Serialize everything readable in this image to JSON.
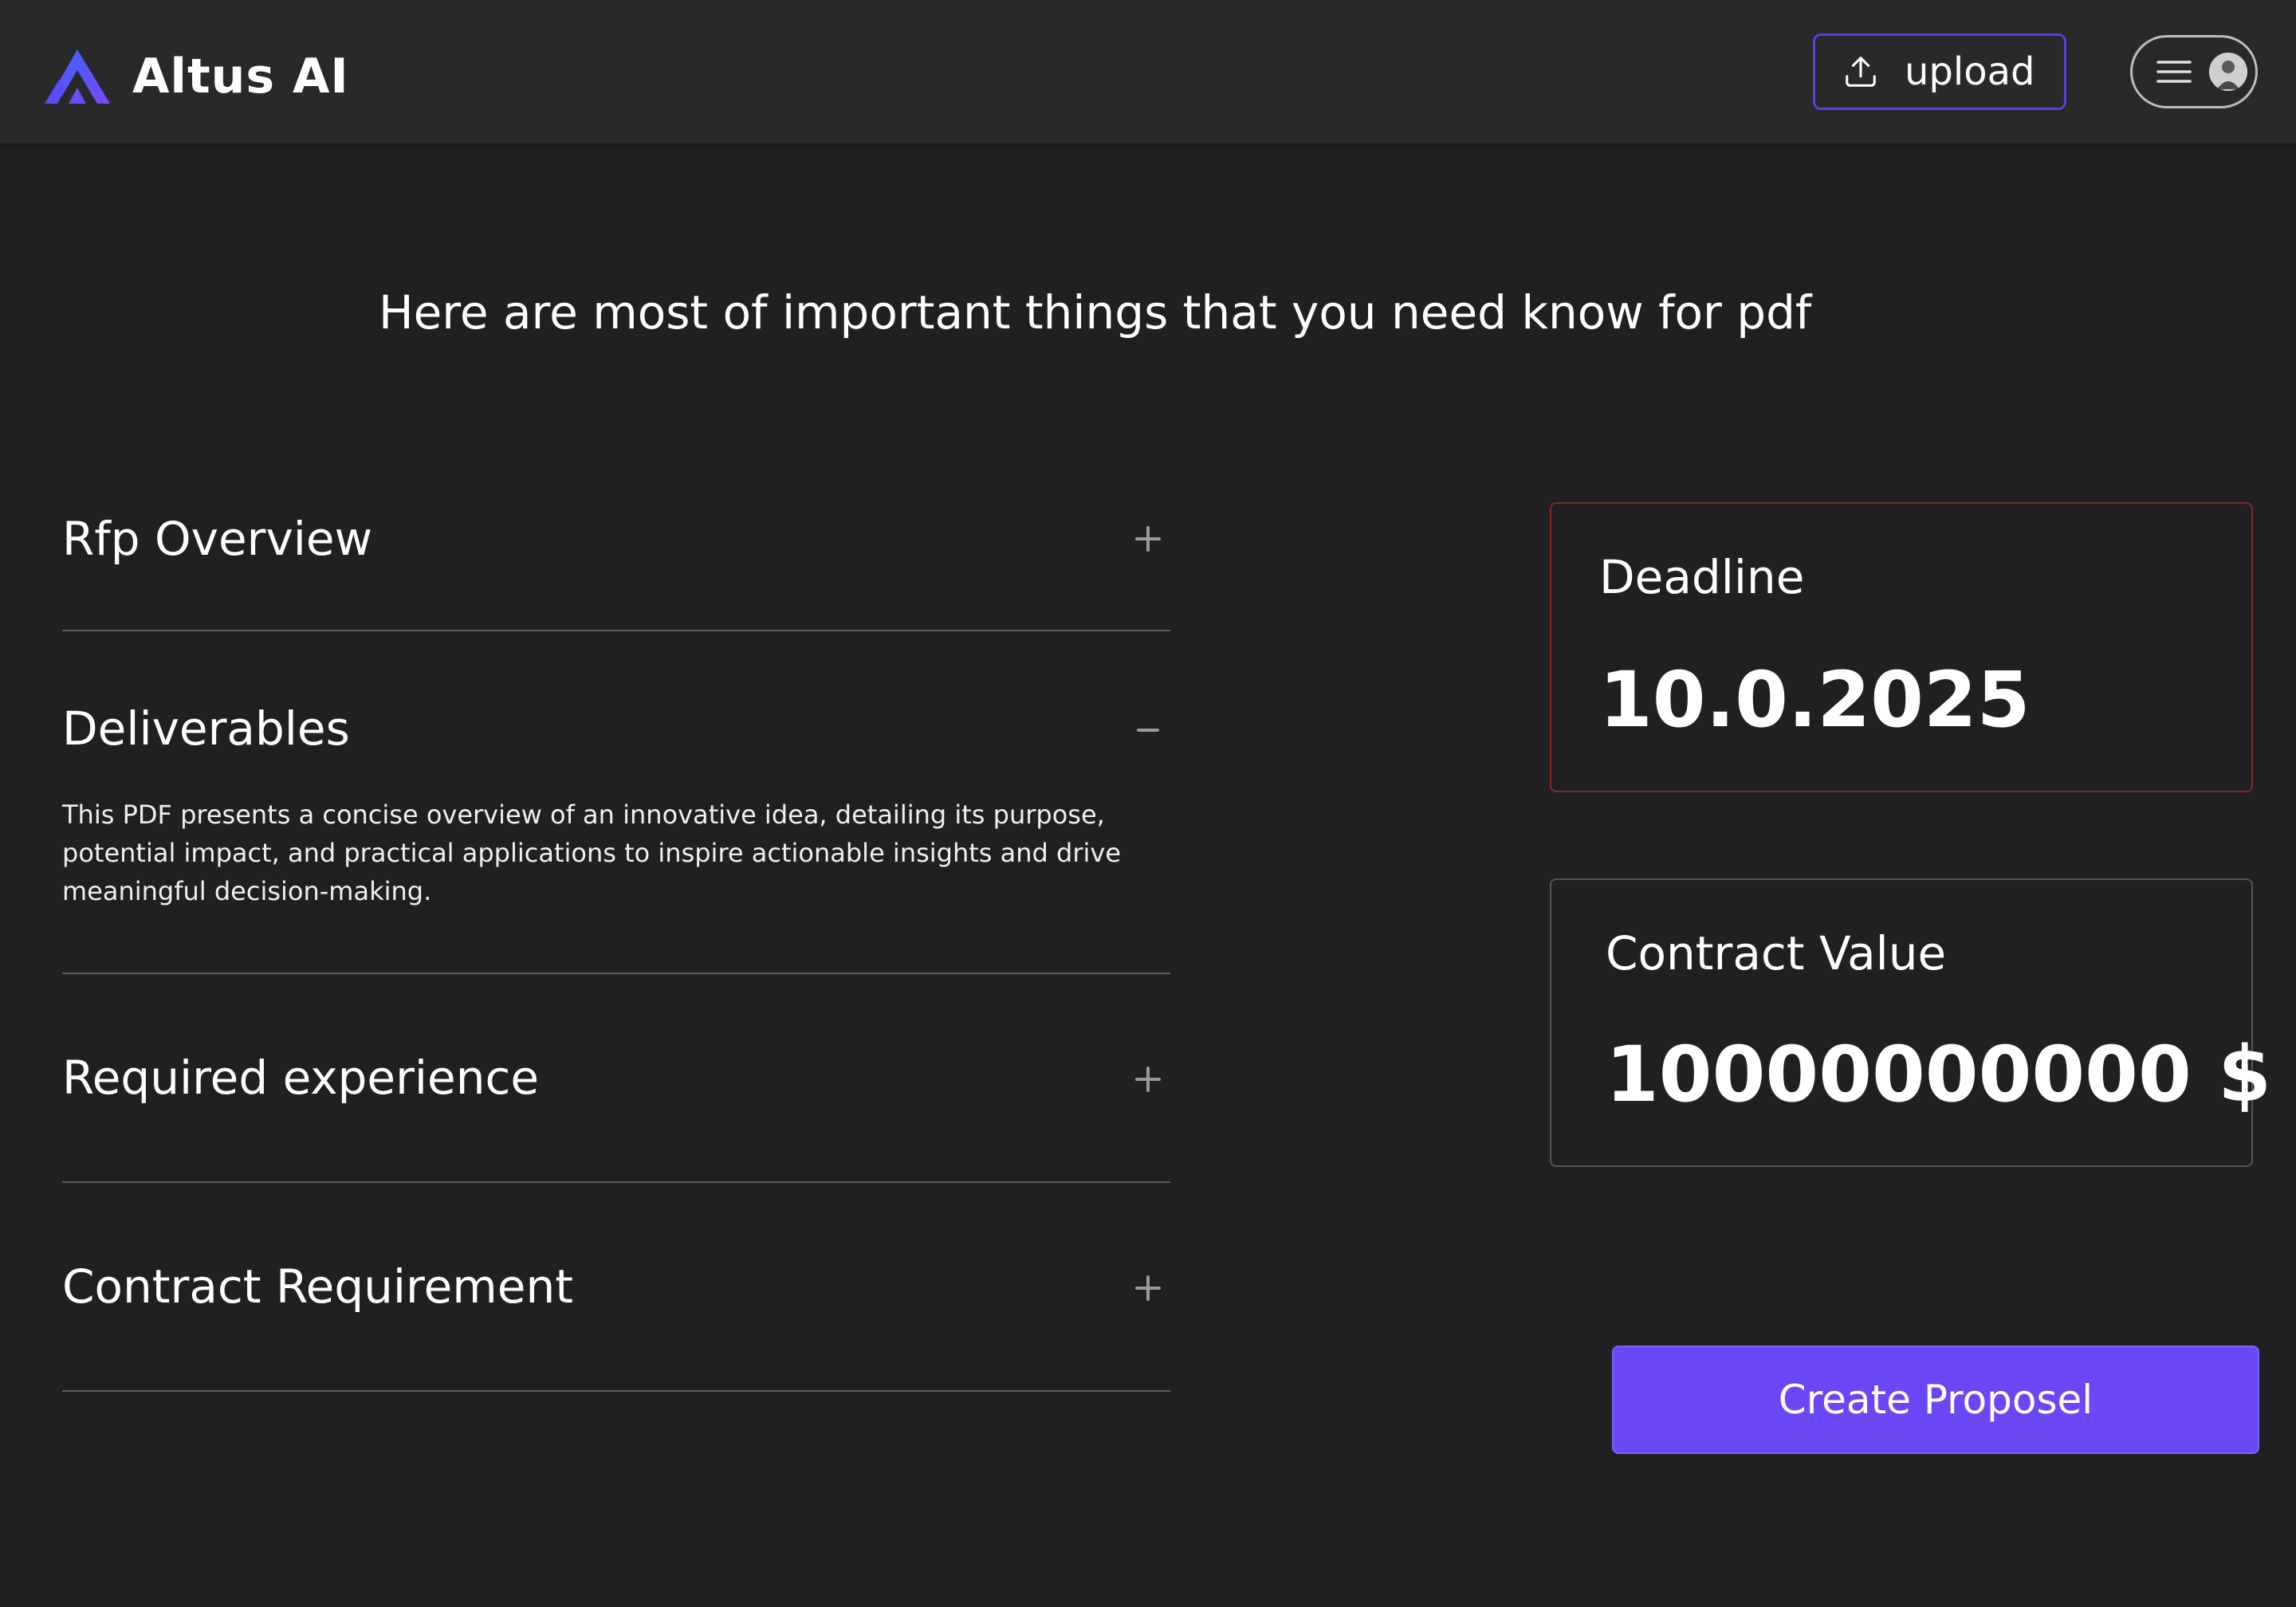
{
  "header": {
    "brand": "Altus AI",
    "upload_label": "upload",
    "icons": {
      "logo": "altus-logo",
      "upload": "upload-icon",
      "menu": "hamburger-icon",
      "avatar": "user-avatar"
    }
  },
  "headline": "Here are most of important things that you need know for pdf",
  "accordion": {
    "items": [
      {
        "title": "Rfp Overview",
        "expanded": false,
        "toggle": "+"
      },
      {
        "title": "Deliverables",
        "expanded": true,
        "toggle": "−",
        "body": "This PDF presents a concise overview of an innovative idea, detailing its purpose, potential impact, and practical applications to inspire actionable insights and drive meaningful decision-making."
      },
      {
        "title": "Required experience",
        "expanded": false,
        "toggle": "+"
      },
      {
        "title": "Contract Requirement",
        "expanded": false,
        "toggle": "+"
      }
    ]
  },
  "cards": {
    "deadline": {
      "label": "Deadline",
      "value": "10.0.2025"
    },
    "contract_value": {
      "label": "Contract Value",
      "value": "10000000000 $"
    }
  },
  "cta": {
    "label": "Create Proposel"
  },
  "colors": {
    "background": "#202022",
    "navbar": "#292929",
    "accent": "#6c47f5",
    "deadline_border": "#7a2d2b",
    "divider": "#5d5d5d"
  }
}
